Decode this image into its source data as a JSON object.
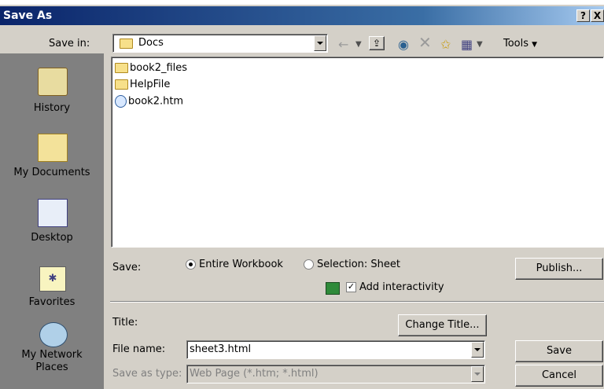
{
  "window": {
    "title": "Save As",
    "help_label": "?",
    "close_label": "X"
  },
  "save_in": {
    "label": "Save in:",
    "value": "Docs"
  },
  "toolbar": {
    "tools_label": "Tools"
  },
  "places": [
    {
      "label": "History",
      "icon": "history-icon"
    },
    {
      "label": "My Documents",
      "icon": "my-documents-icon"
    },
    {
      "label": "Desktop",
      "icon": "desktop-icon"
    },
    {
      "label": "Favorites",
      "icon": "favorites-icon"
    },
    {
      "label": "My Network Places",
      "icon": "network-places-icon"
    }
  ],
  "files": [
    {
      "name": "book2_files",
      "type": "folder"
    },
    {
      "name": "HelpFile",
      "type": "folder"
    },
    {
      "name": "book2.htm",
      "type": "htm"
    }
  ],
  "save_options": {
    "label": "Save:",
    "entire_workbook": "Entire Workbook",
    "selection": "Selection: Sheet",
    "add_interactivity": "Add interactivity",
    "publish": "Publish..."
  },
  "title_field": {
    "label": "Title:",
    "change_title": "Change Title..."
  },
  "file_name": {
    "label": "File name:",
    "value": "sheet3.html"
  },
  "save_as_type": {
    "label": "Save as type:",
    "value": "Web Page (*.htm; *.html)"
  },
  "buttons": {
    "save": "Save",
    "cancel": "Cancel"
  },
  "colors": {
    "title_bar": "#0a246a",
    "dialog_bg": "#d4d0c8"
  }
}
